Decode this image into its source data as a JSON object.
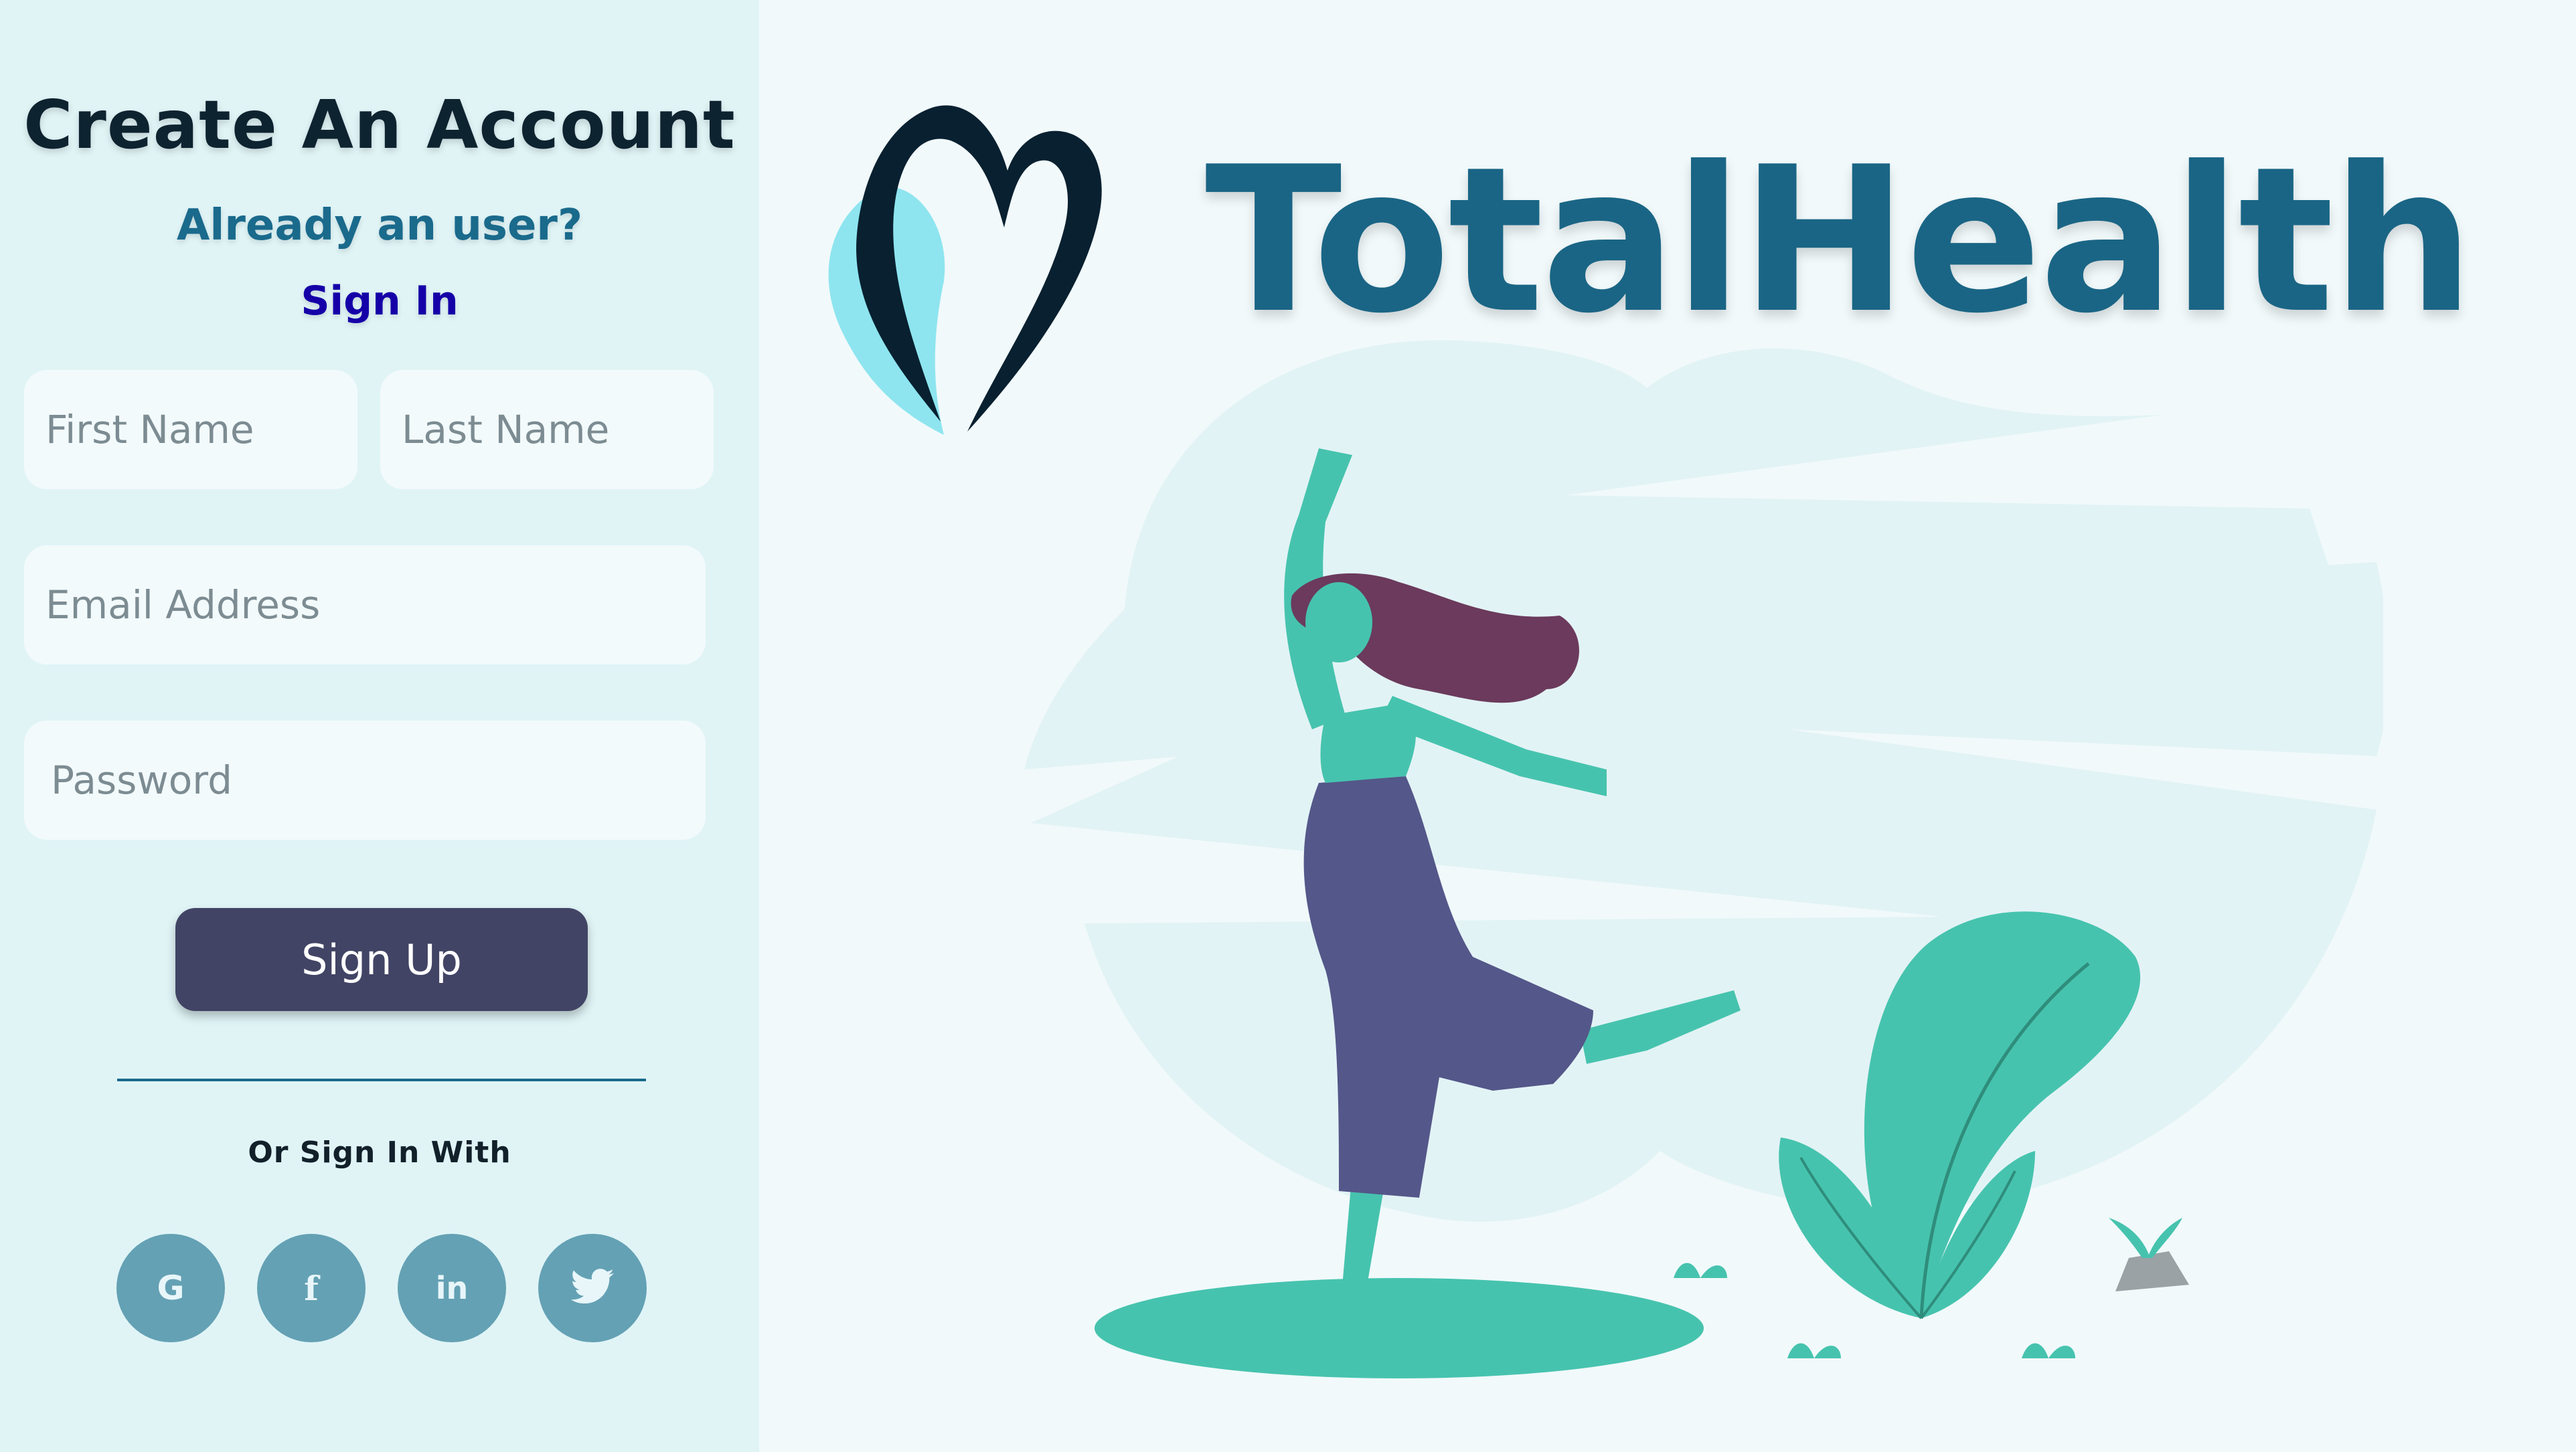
{
  "form": {
    "title": "Create An Account",
    "subtitle": "Already an user?",
    "signin_link": "Sign In",
    "first_name_placeholder": "First Name",
    "last_name_placeholder": "Last Name",
    "email_placeholder": "Email Address",
    "password_placeholder": "Password",
    "signup_label": "Sign Up",
    "or_sign_in_with": "Or Sign In With"
  },
  "social": [
    {
      "label": "G",
      "icon": "google-icon"
    },
    {
      "label": "f",
      "icon": "facebook-icon"
    },
    {
      "label": "in",
      "icon": "linkedin-icon"
    },
    {
      "label": "",
      "icon": "twitter-icon"
    }
  ],
  "brand": {
    "name": "TotalHealth",
    "logo_icon": "heart-logo-icon"
  },
  "colors": {
    "panel_bg": "#e0f4f6",
    "page_bg": "#f1f9fb",
    "brand": "#1a6585",
    "button": "#424465",
    "social": "#64a1b4",
    "illustration_green": "#46c3ae",
    "illustration_purple": "#545789"
  }
}
